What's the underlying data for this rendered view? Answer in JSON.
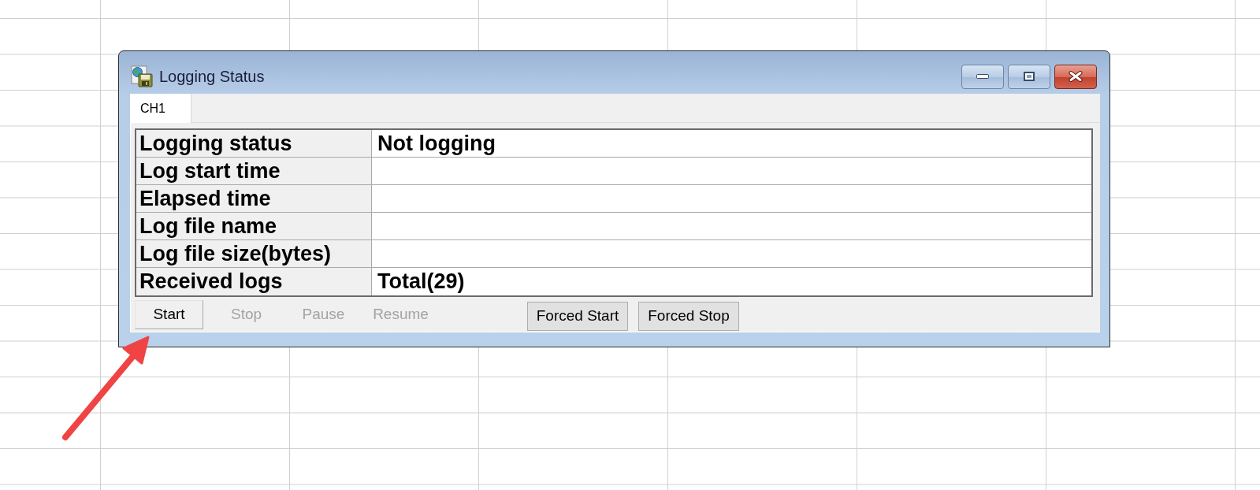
{
  "window": {
    "title": "Logging Status"
  },
  "tabs": [
    {
      "label": "CH1",
      "selected": true
    }
  ],
  "table": {
    "rows": [
      {
        "label": "Logging status",
        "value": "Not logging"
      },
      {
        "label": "Log start time"
      },
      {
        "label": "Elapsed time"
      },
      {
        "label": "Log file name"
      },
      {
        "label": "Log file size(bytes)"
      },
      {
        "label": "Received logs",
        "value": "Total(29)"
      }
    ]
  },
  "logging_buttons": [
    {
      "label": "Start",
      "disabled": false
    },
    {
      "label": "Stop",
      "disabled": true
    },
    {
      "label": "Pause",
      "disabled": true
    },
    {
      "label": "Resume",
      "disabled": true
    }
  ],
  "forced_buttons": [
    {
      "label": "Forced Start",
      "disabled": false
    },
    {
      "label": "Forced Stop",
      "disabled": false
    }
  ]
}
